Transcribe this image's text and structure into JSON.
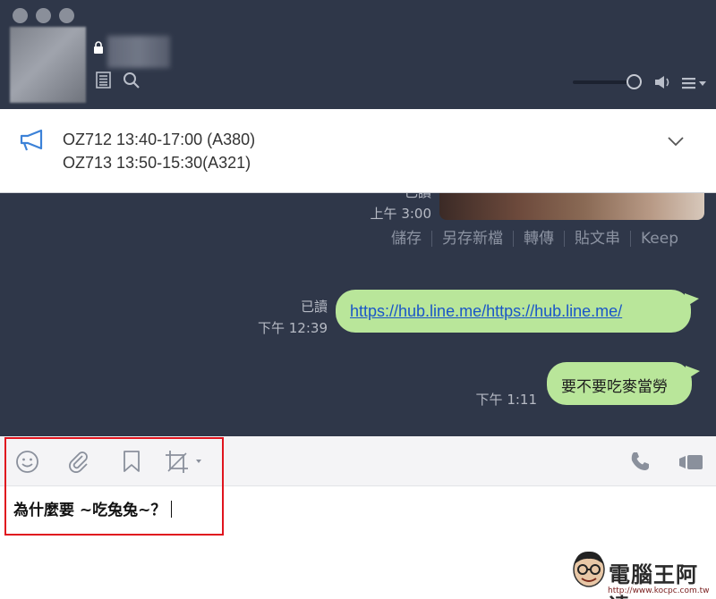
{
  "header": {
    "traffic_lights": [
      "close",
      "minimize",
      "zoom"
    ],
    "icons": {
      "lock": "lock-icon",
      "notes": "notes-icon",
      "search": "search-icon",
      "volume": "speaker-icon",
      "menu": "menu-icon"
    },
    "volume_level": 1.0
  },
  "announcement": {
    "icon": "megaphone-icon",
    "line1": "OZ712 13:40-17:00 (A380)",
    "line2": "OZ713 13:50-15:30(A321)",
    "expand_icon": "chevron-down-icon"
  },
  "chat": {
    "photo_message": {
      "read": "已讀",
      "time": "上午 3:00",
      "actions": [
        "儲存",
        "另存新檔",
        "轉傳",
        "貼文串",
        "Keep"
      ]
    },
    "link_message": {
      "read": "已讀",
      "time": "下午 12:39",
      "text": "https://hub.line.me/https://hub.line.me/"
    },
    "text_message": {
      "time": "下午 1:11",
      "text": "要不要吃麥當勞"
    }
  },
  "toolbar": {
    "emoji_icon": "emoji-icon",
    "attach_icon": "paperclip-icon",
    "keep_icon": "bookmark-icon",
    "screenshot_icon": "crop-icon",
    "call_icon": "phone-icon",
    "video_icon": "video-icon"
  },
  "input": {
    "value": "為什麼要 ~吃兔兔~？"
  },
  "colors": {
    "header_bg": "#2f3749",
    "chat_bg": "#2f3749",
    "bubble": "#b9e69a",
    "link": "#1a56c8",
    "highlight_box": "#e0141e"
  },
  "watermark": {
    "title": "電腦王阿達",
    "url": "http://www.kocpc.com.tw"
  }
}
